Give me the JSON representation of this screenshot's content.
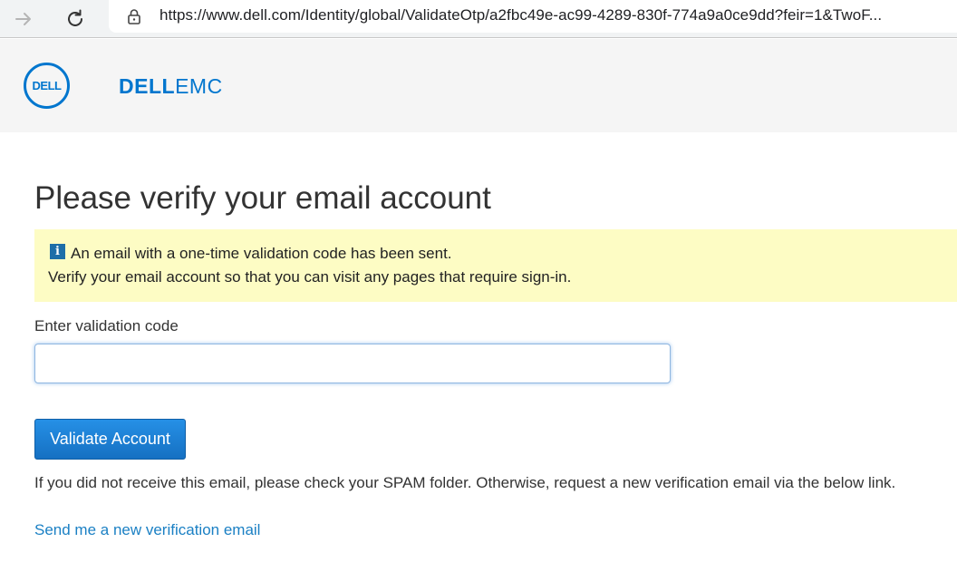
{
  "browser": {
    "url": "https://www.dell.com/Identity/global/ValidateOtp/a2fbc49e-ac99-4289-830f-774a9a0ce9dd?feir=1&TwoF..."
  },
  "header": {
    "logo_text": "DELL",
    "brand_bold": "DELL",
    "brand_light": "EMC"
  },
  "main": {
    "title": "Please verify your email account",
    "info": {
      "icon_glyph": "i",
      "line1": "An email with a one-time validation code has been sent.",
      "line2": "Verify your email account so that you can visit any pages that require sign-in."
    },
    "code_field": {
      "label": "Enter validation code",
      "value": "",
      "placeholder": ""
    },
    "validate_label": "Validate Account",
    "spam_note": "If you did not receive this email, please check your SPAM folder. Otherwise, request a new verification email via the below link.",
    "resend_link": "Send me a new verification email"
  },
  "colors": {
    "brand_blue": "#0076ce",
    "button_blue": "#1a7fd6",
    "info_bg": "#fdfcc4",
    "link_blue": "#1b80c4"
  }
}
